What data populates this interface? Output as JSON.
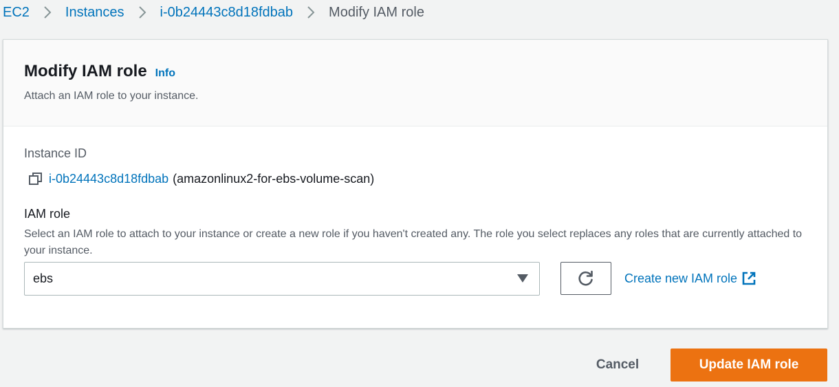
{
  "breadcrumb": {
    "items": [
      "EC2",
      "Instances",
      "i-0b24443c8d18fdbab"
    ],
    "current": "Modify IAM role"
  },
  "panel": {
    "title": "Modify IAM role",
    "info_label": "Info",
    "description": "Attach an IAM role to your instance."
  },
  "instance": {
    "label": "Instance ID",
    "id": "i-0b24443c8d18fdbab",
    "name": "(amazonlinux2-for-ebs-volume-scan)"
  },
  "iam_role": {
    "label": "IAM role",
    "help": "Select an IAM role to attach to your instance or create a new role if you haven't created any. The role you select replaces any roles that are currently attached to your instance.",
    "selected": "ebs",
    "create_link": "Create new IAM role"
  },
  "actions": {
    "cancel": "Cancel",
    "update": "Update IAM role"
  },
  "colors": {
    "link": "#0073bb",
    "primary": "#ec7211",
    "background": "#f2f3f3"
  },
  "icons": [
    "chevron-right-icon",
    "copy-icon",
    "refresh-icon",
    "external-link-icon",
    "caret-down-icon"
  ]
}
